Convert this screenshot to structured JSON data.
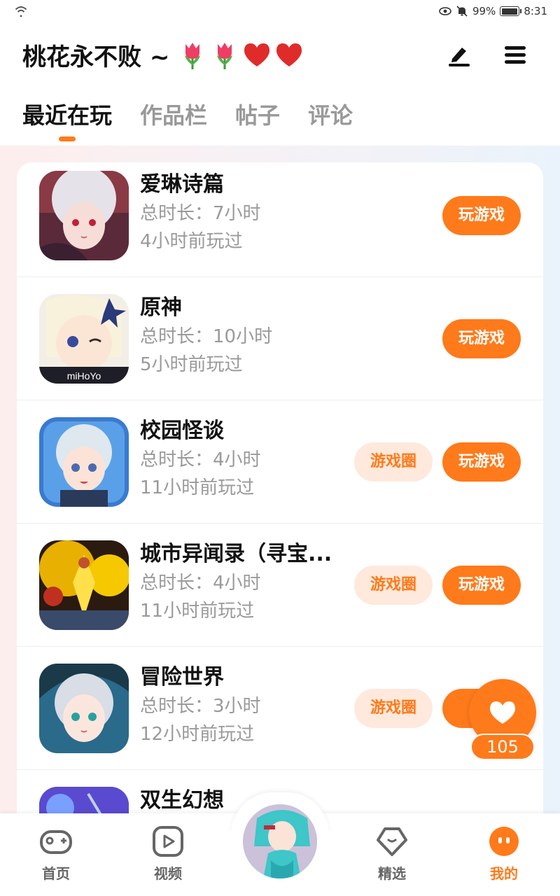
{
  "status_bar": {
    "battery": "99%",
    "time": "8:31"
  },
  "header": {
    "username": "桃花永不败 ~",
    "emojis": [
      "tulip-icon",
      "tulip-icon",
      "heart-icon",
      "heart-icon"
    ]
  },
  "tabs": [
    {
      "label": "最近在玩",
      "active": true
    },
    {
      "label": "作品栏",
      "active": false
    },
    {
      "label": "帖子",
      "active": false
    },
    {
      "label": "评论",
      "active": false
    }
  ],
  "games": [
    {
      "name": "爱琳诗篇",
      "duration": "总时长：7小时",
      "last_played": "4小时前玩过",
      "has_circle": false,
      "play_label": "玩游戏",
      "circle_label": ""
    },
    {
      "name": "原神",
      "duration": "总时长：10小时",
      "last_played": "5小时前玩过",
      "has_circle": false,
      "play_label": "玩游戏",
      "circle_label": ""
    },
    {
      "name": "校园怪谈",
      "duration": "总时长：4小时",
      "last_played": "11小时前玩过",
      "has_circle": true,
      "play_label": "玩游戏",
      "circle_label": "游戏圈"
    },
    {
      "name": "城市异闻录（寻宝...",
      "duration": "总时长：4小时",
      "last_played": "11小时前玩过",
      "has_circle": true,
      "play_label": "玩游戏",
      "circle_label": "游戏圈"
    },
    {
      "name": "冒险世界",
      "duration": "总时长：3小时",
      "last_played": "12小时前玩过",
      "has_circle": true,
      "play_label": "玩",
      "circle_label": "游戏圈"
    },
    {
      "name": "双生幻想",
      "duration": "",
      "last_played": "",
      "has_circle": true,
      "play_label": "",
      "circle_label": ""
    }
  ],
  "floating_like": {
    "count": "105"
  },
  "bottom_nav": [
    {
      "label": "首页",
      "icon": "gamepad-icon",
      "active": false
    },
    {
      "label": "视频",
      "icon": "video-icon",
      "active": false
    },
    {
      "label": "精选",
      "icon": "heart-chat-icon",
      "active": false
    },
    {
      "label": "我的",
      "icon": "face-icon",
      "active": true
    }
  ],
  "colors": {
    "accent": "#ff7a1a",
    "accent_light": "#ffe9dc",
    "muted_text": "#9a9a9a"
  }
}
